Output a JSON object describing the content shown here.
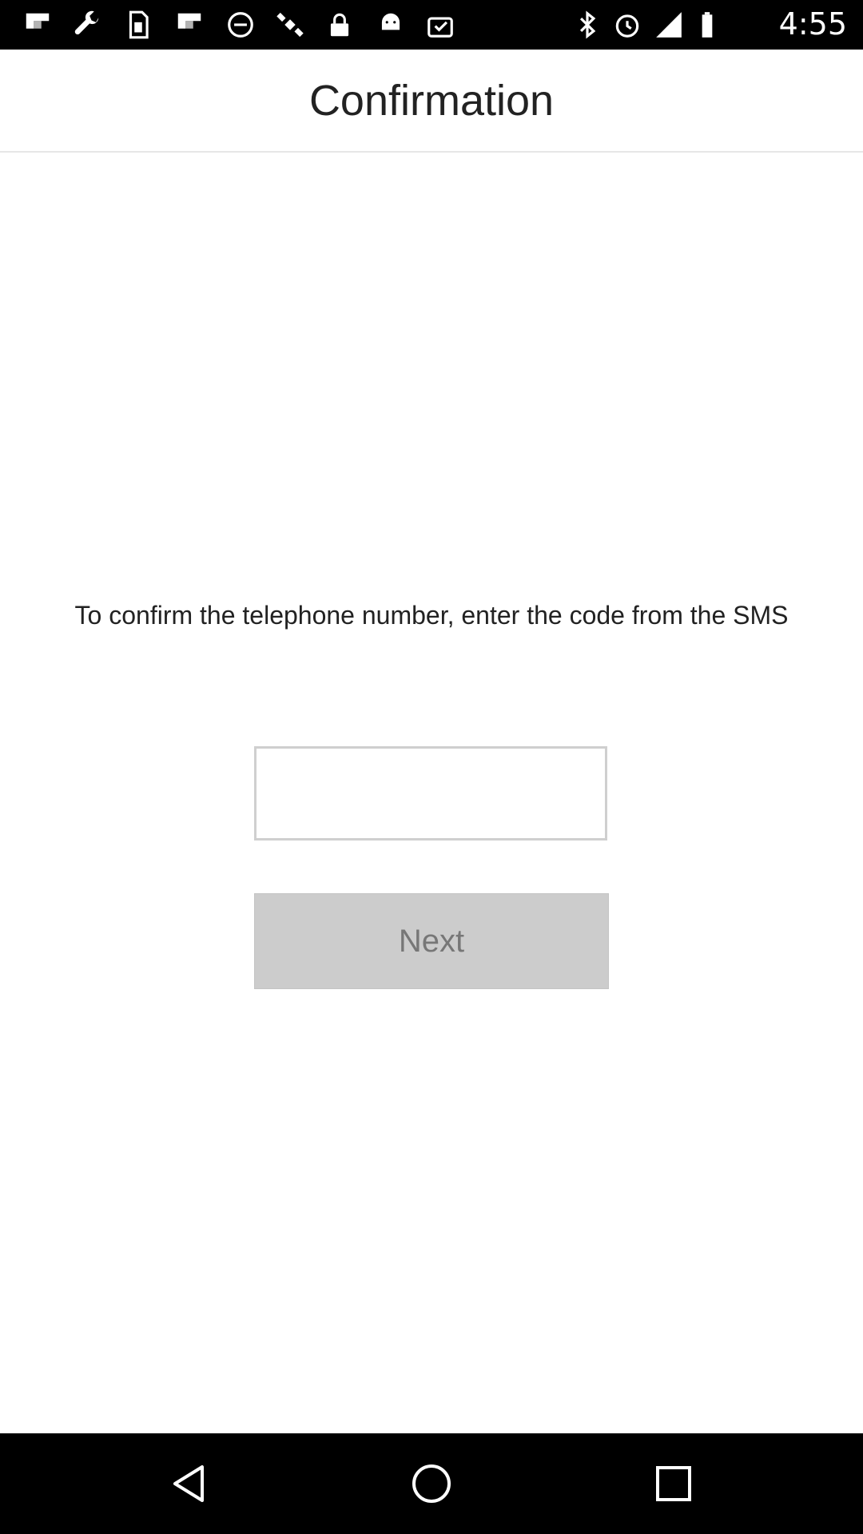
{
  "status_bar": {
    "time": "4:55",
    "left_icons": [
      "flipboard-icon",
      "wrench-icon",
      "sim-card-icon",
      "flipboard-icon",
      "blocked-icon",
      "satellite-icon",
      "lock-icon",
      "android-icon",
      "clipboard-check-icon"
    ],
    "right_icons": [
      "bluetooth-icon",
      "alarm-icon",
      "signal-icon",
      "battery-icon"
    ]
  },
  "header": {
    "title": "Confirmation"
  },
  "main": {
    "instruction": "To confirm the telephone number, enter the code from the SMS",
    "code_input": {
      "value": "",
      "placeholder": ""
    },
    "next_label": "Next"
  },
  "nav_bar": {
    "buttons": [
      "back-icon",
      "home-icon",
      "recents-icon"
    ]
  },
  "colors": {
    "status_bar": "#000000",
    "button_bg": "#cccccc",
    "button_text": "#777777"
  }
}
